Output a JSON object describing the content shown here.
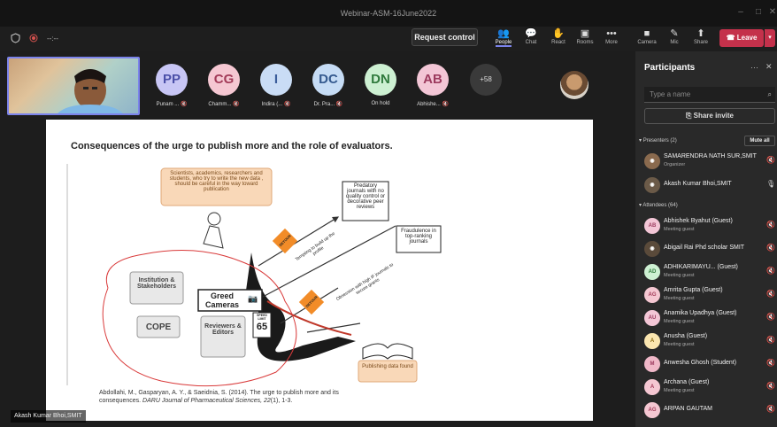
{
  "window": {
    "title": "Webinar-ASM-16June2022",
    "controls": [
      "–",
      "□",
      "✕"
    ]
  },
  "toolbar": {
    "timer": "--:--",
    "request_control": "Request control",
    "tools": [
      {
        "label": "People",
        "icon": "people-icon",
        "glyph": "👥",
        "active": true
      },
      {
        "label": "Chat",
        "icon": "chat-icon",
        "glyph": "💬",
        "active": false
      },
      {
        "label": "React",
        "icon": "react-icon",
        "glyph": "✋",
        "active": false
      },
      {
        "label": "Rooms",
        "icon": "rooms-icon",
        "glyph": "▣",
        "active": false
      },
      {
        "label": "More",
        "icon": "more-icon",
        "glyph": "•••",
        "active": false
      },
      {
        "label": "Camera",
        "icon": "camera-off-icon",
        "glyph": "■",
        "active": false
      },
      {
        "label": "Mic",
        "icon": "mic-off-icon",
        "glyph": "✎",
        "active": false
      },
      {
        "label": "Share",
        "icon": "share-icon",
        "glyph": "⬆",
        "active": false
      }
    ],
    "leave": "Leave"
  },
  "gallery": {
    "tiles": [
      {
        "initials": "PP",
        "name": "Punam ...",
        "bg": "#c8c6f5",
        "fg": "#4b4fa8"
      },
      {
        "initials": "CG",
        "name": "Chamm...",
        "bg": "#f5c7d2",
        "fg": "#a23a58"
      },
      {
        "initials": "I",
        "name": "Indira (...",
        "bg": "#c9dcf5",
        "fg": "#3a5c9a"
      },
      {
        "initials": "DC",
        "name": "Dr. Pra...",
        "bg": "#c6dcf5",
        "fg": "#355a8f"
      },
      {
        "initials": "DN",
        "name": "On hold",
        "bg": "#cdf0d2",
        "fg": "#2f7a3c"
      },
      {
        "initials": "AB",
        "name": "Abhishe...",
        "bg": "#f3c6d6",
        "fg": "#9c3a5e"
      }
    ],
    "more": "+58"
  },
  "slide": {
    "title": "Consequences of the urge to publish more and the role of evaluators.",
    "top_box": "Scientists, academics, researchers and students, who try to write the new data , should be careful in the way toward publication",
    "predatory": "Predatory journals with no quality control or decorative peer reviews",
    "fraud": "Fraudulence in top-ranking journals",
    "detour": "DETOUR",
    "tempting": "Tempting to build up the profile",
    "obsession": "Obsession with high IF journals to secure grants",
    "institution": "Institution & Stakeholders",
    "greed": "Greed Cameras",
    "speed_label": "SPEED LIMIT",
    "speed_value": "65",
    "cope": "COPE",
    "reviewers": "Reviewers & Editors",
    "publishing": "Publishing data found",
    "citation_line1": "Abdollahi, M., Gasparyan, A. Y., & Saeidnia, S. (2014). The urge to publish more and its",
    "citation_line2_plain": "consequences.",
    "citation_line2_italic": "DARU Journal of Pharmaceutical Sciences, 22",
    "citation_line2_end": "(1), 1-3."
  },
  "presenter_label": "Akash Kumar Bhoi,SMIT",
  "panel": {
    "title": "Participants",
    "search_placeholder": "Type a name",
    "share_invite": "Share invite",
    "presenters_label": "Presenters (2)",
    "mute_all": "Mute all",
    "attendees_label": "Attendees (64)",
    "presenters": [
      {
        "name": "SAMARENDRA NATH SUR,SMIT",
        "sub": "Organizer",
        "initials": "",
        "bg": "#8a6a4e",
        "fg": "#fff"
      },
      {
        "name": "Akash Kumar Bhoi,SMIT",
        "sub": "",
        "initials": "",
        "bg": "#6b5a48",
        "fg": "#fff"
      }
    ],
    "attendees": [
      {
        "name": "Abhishek Byahut (Guest)",
        "sub": "Meeting guest",
        "initials": "AB",
        "bg": "#f3c6d6",
        "fg": "#9c3a5e"
      },
      {
        "name": "Abigail Rai Phd scholar SMIT",
        "sub": "",
        "initials": "",
        "bg": "#5a4a3a",
        "fg": "#fff"
      },
      {
        "name": "ADHIKARIMAYU... (Guest)",
        "sub": "Meeting guest",
        "initials": "AD",
        "bg": "#cdf0d2",
        "fg": "#2f7a3c"
      },
      {
        "name": "Amrita Gupta (Guest)",
        "sub": "Meeting guest",
        "initials": "AG",
        "bg": "#f5c7d2",
        "fg": "#a23a58"
      },
      {
        "name": "Anamika Upadhya (Guest)",
        "sub": "Meeting guest",
        "initials": "AU",
        "bg": "#f3c6d6",
        "fg": "#9c3a5e"
      },
      {
        "name": "Anusha (Guest)",
        "sub": "Meeting guest",
        "initials": "A",
        "bg": "#fbe6b0",
        "fg": "#8a6a12"
      },
      {
        "name": "Anwesha Ghosh (Student)",
        "sub": "",
        "initials": "M",
        "bg": "#f0b8c8",
        "fg": "#9c3a5e"
      },
      {
        "name": "Archana (Guest)",
        "sub": "Meeting guest",
        "initials": "A",
        "bg": "#f5c7d2",
        "fg": "#a23a58"
      },
      {
        "name": "ARPAN GAUTAM",
        "sub": "",
        "initials": "AG",
        "bg": "#f5c7d2",
        "fg": "#a23a58"
      }
    ]
  }
}
